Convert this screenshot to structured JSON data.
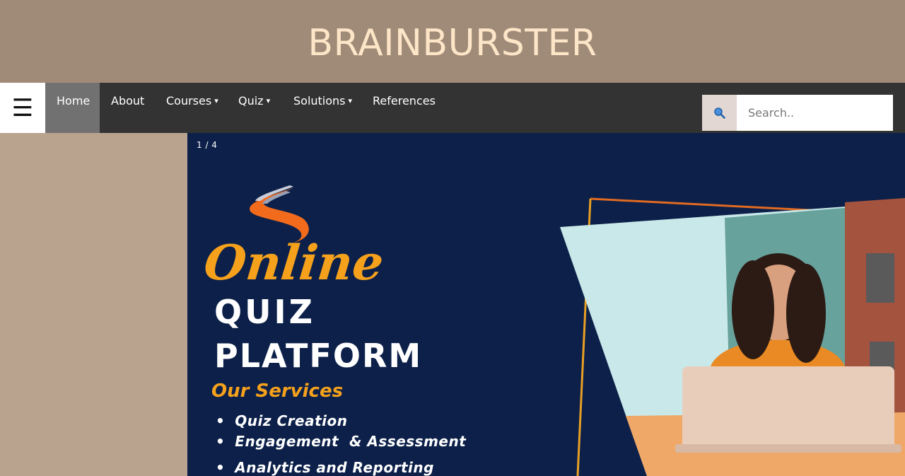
{
  "header": {
    "brand": "BRAINBURSTER"
  },
  "nav": {
    "menu_icon": "hamburger-menu-icon",
    "items": [
      {
        "label": "Home",
        "active": true,
        "dropdown": false
      },
      {
        "label": "About",
        "active": false,
        "dropdown": false
      },
      {
        "label": "Courses",
        "active": false,
        "dropdown": true
      },
      {
        "label": "Quiz",
        "active": false,
        "dropdown": true
      },
      {
        "label": "Solutions",
        "active": false,
        "dropdown": true
      },
      {
        "label": "References",
        "active": false,
        "dropdown": false
      }
    ],
    "caret": "▾"
  },
  "search": {
    "placeholder": "Search..",
    "icon": "magnifier-icon"
  },
  "slider": {
    "counter": "1 / 4",
    "banner": {
      "script_title": "Online",
      "title_line1": "QUIZ",
      "title_line2": "PLATFORM",
      "subtitle": "Our Services",
      "services": [
        "Quiz Creation",
        "Engagement  & Assessment",
        "Analytics and Reporting"
      ]
    }
  },
  "colors": {
    "header_bg": "#a08b79",
    "brand_text": "#fde5c7",
    "nav_bg": "#333333",
    "nav_active": "#717171",
    "page_bg": "#b9a38e",
    "banner_bg": "#0c2049",
    "accent_orange": "#f5a11c"
  }
}
